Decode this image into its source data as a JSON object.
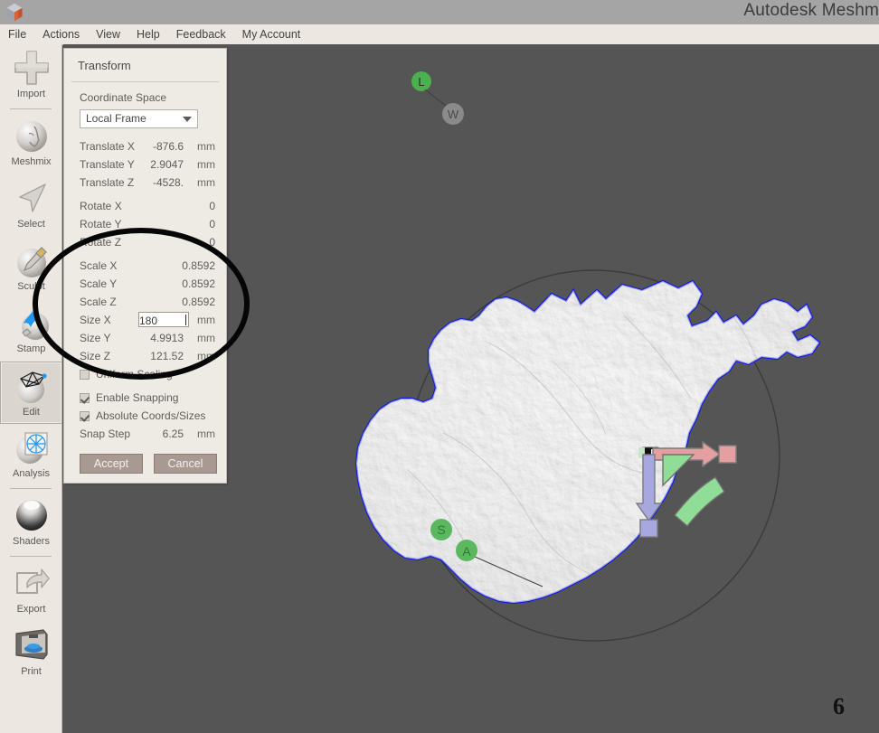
{
  "window": {
    "title": "Autodesk Meshm",
    "logo_icon": "meshmixer-cube-icon"
  },
  "menubar": {
    "items": [
      {
        "label": "File"
      },
      {
        "label": "Actions"
      },
      {
        "label": "View"
      },
      {
        "label": "Help"
      },
      {
        "label": "Feedback"
      },
      {
        "label": "My Account"
      }
    ]
  },
  "toolrail": {
    "items": [
      {
        "label": "Import",
        "icon": "plus-icon",
        "selected": false,
        "sep_after": true
      },
      {
        "label": "Meshmix",
        "icon": "face-sphere-icon",
        "selected": false,
        "sep_after": false
      },
      {
        "label": "Select",
        "icon": "cursor-arrow-icon",
        "selected": false,
        "sep_after": false
      },
      {
        "label": "Sculpt",
        "icon": "sculpt-brush-icon",
        "selected": false,
        "sep_after": false
      },
      {
        "label": "Stamp",
        "icon": "stamp-icon",
        "selected": false,
        "sep_after": false
      },
      {
        "label": "Edit",
        "icon": "mesh-edit-icon",
        "selected": true,
        "sep_after": false
      },
      {
        "label": "Analysis",
        "icon": "analysis-mesh-icon",
        "selected": false,
        "sep_after": true
      },
      {
        "label": "Shaders",
        "icon": "shader-sphere-icon",
        "selected": false,
        "sep_after": true
      },
      {
        "label": "Export",
        "icon": "export-arrow-icon",
        "selected": false,
        "sep_after": false
      },
      {
        "label": "Print",
        "icon": "printer-3d-icon",
        "selected": false,
        "sep_after": false
      }
    ]
  },
  "transform_panel": {
    "title": "Transform",
    "coordinate_space_label": "Coordinate Space",
    "coordinate_space_value": "Local Frame",
    "coordinate_space_icon": "chevron-down-icon",
    "rows": [
      {
        "name": "Translate X",
        "value": "-876.6",
        "unit": "mm"
      },
      {
        "name": "Translate Y",
        "value": "2.9047",
        "unit": "mm"
      },
      {
        "name": "Translate Z",
        "value": "-4528.",
        "unit": "mm"
      },
      {
        "name": "Rotate X",
        "value": "0",
        "unit": ""
      },
      {
        "name": "Rotate Y",
        "value": "0",
        "unit": ""
      },
      {
        "name": "Rotate Z",
        "value": "0",
        "unit": ""
      },
      {
        "name": "Scale X",
        "value": "0.8592",
        "unit": ""
      },
      {
        "name": "Scale Y",
        "value": "0.8592",
        "unit": ""
      },
      {
        "name": "Scale Z",
        "value": "0.8592",
        "unit": ""
      }
    ],
    "size_x": {
      "name": "Size X",
      "value": "180",
      "unit": "mm",
      "editing": true
    },
    "size_rows": [
      {
        "name": "Size Y",
        "value": "4.9913",
        "unit": "mm"
      },
      {
        "name": "Size Z",
        "value": "121.52",
        "unit": "mm"
      }
    ],
    "checkboxes": [
      {
        "label": "Uniform Scaling",
        "checked": false
      },
      {
        "label": "Enable Snapping",
        "checked": true
      },
      {
        "label": "Absolute Coords/Sizes",
        "checked": true
      }
    ],
    "snap_step": {
      "name": "Snap Step",
      "value": "6.25",
      "unit": "mm"
    },
    "accept_label": "Accept",
    "cancel_label": "Cancel"
  },
  "viewport": {
    "model_name": "terrain-relief-mesh",
    "gizmo": {
      "name": "transform-gizmo",
      "x_axis_color": "#e09a9a",
      "y_axis_color": "#9a9ae0",
      "rotate_color": "#8fdb96"
    },
    "markers": [
      {
        "label": "L",
        "color": "#4caf50",
        "type": "pin"
      },
      {
        "label": "W",
        "color": "#808080",
        "type": "pin"
      },
      {
        "label": "S",
        "color": "#4caf50",
        "type": "pin"
      },
      {
        "label": "A",
        "color": "#4caf50",
        "type": "pin"
      }
    ],
    "outline_color": "#0b16ea",
    "background_color": "#555555"
  },
  "annotations": {
    "page_number": "6",
    "highlight_ellipse": "hand-drawn-ellipse-around-size-fields"
  }
}
